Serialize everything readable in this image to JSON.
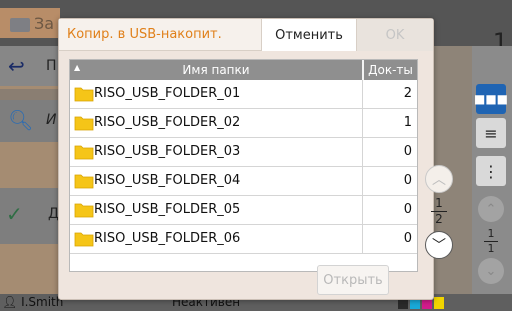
{
  "background": {
    "tab_title": "За",
    "page_number": "1",
    "back_row_char": "П",
    "search_row_char": "И",
    "check_row_char": "Д",
    "right_page": {
      "current": "1",
      "total": "1"
    },
    "status": {
      "user": "I.Smith",
      "state": "Неактивен",
      "inks": [
        "K",
        "C",
        "M",
        "Y"
      ]
    }
  },
  "dialog": {
    "title": "Копир. в USB-накопит.",
    "cancel_label": "Отменить",
    "ok_label": "OK",
    "open_label": "Открыть",
    "columns": {
      "name": "Имя папки",
      "docs": "Док-ты"
    },
    "rows": [
      {
        "name": "RISO_USB_FOLDER_01",
        "count": "2"
      },
      {
        "name": "RISO_USB_FOLDER_02",
        "count": "1"
      },
      {
        "name": "RISO_USB_FOLDER_03",
        "count": "0"
      },
      {
        "name": "RISO_USB_FOLDER_04",
        "count": "0"
      },
      {
        "name": "RISO_USB_FOLDER_05",
        "count": "0"
      },
      {
        "name": "RISO_USB_FOLDER_06",
        "count": "0"
      }
    ],
    "pager": {
      "current": "1",
      "total": "2"
    }
  },
  "colors": {
    "accent": "#e0801a",
    "folder": "#f5c518",
    "header_gray": "#8f8f8f",
    "blue": "#1f64b3"
  }
}
